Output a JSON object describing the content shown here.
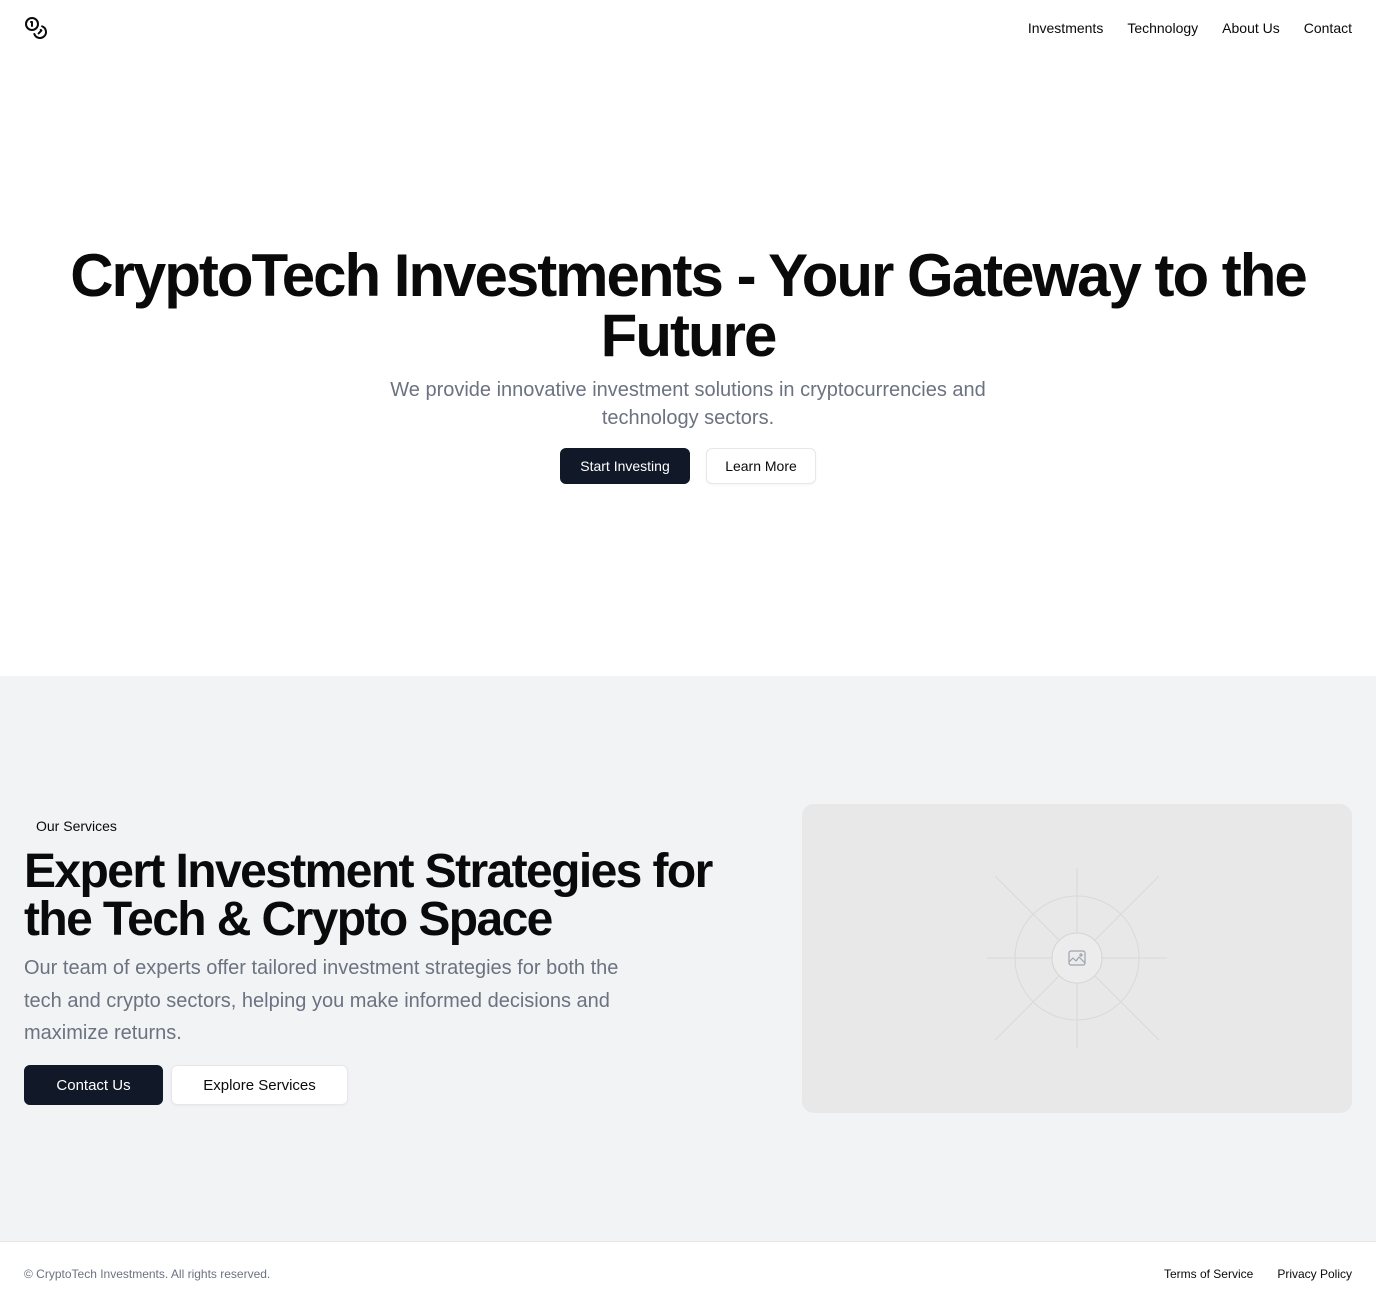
{
  "header": {
    "logo_icon": "coins-icon",
    "nav": [
      {
        "label": "Investments"
      },
      {
        "label": "Technology"
      },
      {
        "label": "About Us"
      },
      {
        "label": "Contact"
      }
    ]
  },
  "hero": {
    "title": "CryptoTech Investments - Your Gateway to the Future",
    "subtitle": "We provide innovative investment solutions in cryptocurrencies and technology sectors.",
    "primary_button": "Start Investing",
    "secondary_button": "Learn More"
  },
  "services": {
    "badge": "Our Services",
    "title": "Expert Investment Strategies for the Tech & Crypto Space",
    "description": "Our team of experts offer tailored investment strategies for both the tech and crypto sectors, helping you make informed decisions and maximize returns.",
    "primary_button": "Contact Us",
    "secondary_button": "Explore Services",
    "image_icon": "image-placeholder-icon"
  },
  "footer": {
    "copyright": "© CryptoTech Investments. All rights reserved.",
    "links": [
      {
        "label": "Terms of Service"
      },
      {
        "label": "Privacy Policy"
      }
    ]
  },
  "colors": {
    "primary_button_bg": "#111827",
    "muted_text": "#6b7280",
    "section_bg": "#f2f3f5",
    "placeholder_bg": "#e8e8e8"
  }
}
